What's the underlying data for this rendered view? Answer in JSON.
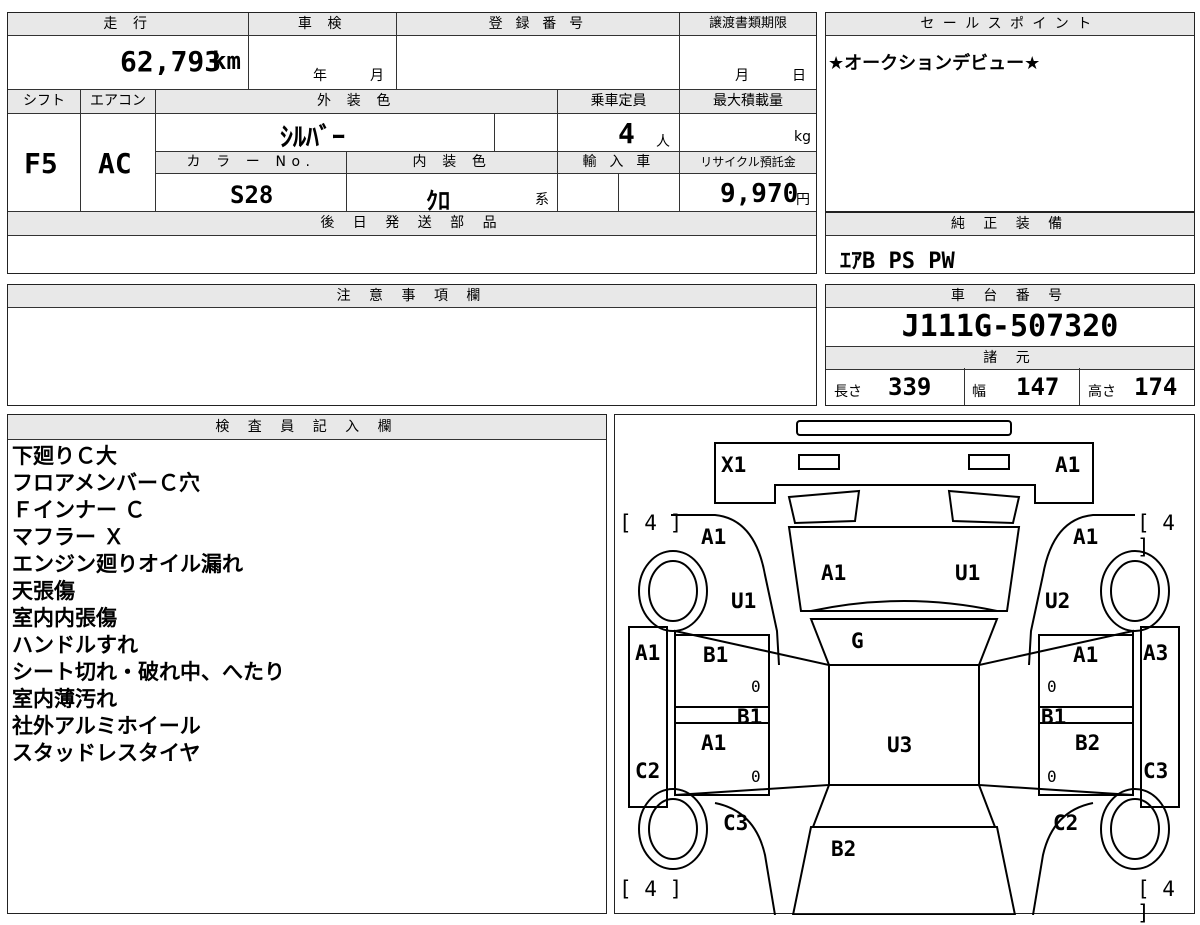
{
  "vehicle": {
    "mileage_label": "走 行",
    "mileage_value": "62,793",
    "mileage_unit": "km",
    "shaken_label": "車 検",
    "shaken_year": "年",
    "shaken_month": "月",
    "reg_label": "登 録 番 号",
    "transfer_label": "譲渡書類期限",
    "transfer_month": "月",
    "transfer_day": "日",
    "shift_label": "シフト",
    "shift_value": "F5",
    "ac_label": "エアコン",
    "ac_value": "AC",
    "exterior_label": "外 装 色",
    "exterior_value": "ｼﾙﾊﾞｰ",
    "capacity_label": "乗車定員",
    "capacity_value": "4",
    "capacity_unit": "人",
    "load_label": "最大積載量",
    "load_unit": "kg",
    "colorno_label": "カ ラ ー No.",
    "colorno_value": "S28",
    "interior_label": "内 装 色",
    "interior_value": "ｸﾛ",
    "interior_suffix": "系",
    "import_label": "輸 入 車",
    "recycle_label": "リサイクル預託金",
    "recycle_value": "9,970",
    "recycle_unit": "円",
    "later_parts_label": "後 日 発 送 部 品"
  },
  "sales": {
    "label": "セールスポイント",
    "text": "★オークションデビュー★"
  },
  "equipment": {
    "label": "純 正 装 備",
    "value": "ｴｱB PS PW"
  },
  "caution": {
    "label": "注 意 事 項 欄"
  },
  "chassis": {
    "label": "車 台 番 号",
    "value": "J111G-507320",
    "specs_label": "諸 元",
    "length_label": "長さ",
    "length_value": "339",
    "width_label": "幅",
    "width_value": "147",
    "height_label": "高さ",
    "height_value": "174"
  },
  "inspector": {
    "label": "検 査 員 記 入 欄",
    "notes": [
      "下廻りＣ大",
      "フロアメンバーＣ穴",
      "Ｆインナー Ｃ",
      "マフラー Ｘ",
      "エンジン廻りオイル漏れ",
      "天張傷",
      "室内内張傷",
      "ハンドルすれ",
      "シート切れ・破れ中、へたり",
      "室内薄汚れ",
      "社外アルミホイール",
      "スタッドレスタイヤ"
    ]
  },
  "diagram": {
    "codes": {
      "x1": "X1",
      "a1_front_r": "A1",
      "a1_fender_l": "A1",
      "a1_fender_r": "A1",
      "a1_hood": "A1",
      "u1_hood": "U1",
      "u1_l": "U1",
      "u2_r": "U2",
      "g_windshield": "G",
      "a1_side_l": "A1",
      "a3_side_r": "A3",
      "b1_door_fl": "B1",
      "a1_door_fr": "A1",
      "b1_center_l": "B1",
      "b1_center_r": "B1",
      "a1_door_rl": "A1",
      "b2_door_rr": "B2",
      "u3_roof": "U3",
      "c2_side_l": "C2",
      "c3_side_r": "C3",
      "c3_rear_l": "C3",
      "c2_rear_r": "C2",
      "b2_back": "B2"
    },
    "tire_depth": "4",
    "door_marks": [
      "0",
      "0",
      "0",
      "0"
    ]
  }
}
